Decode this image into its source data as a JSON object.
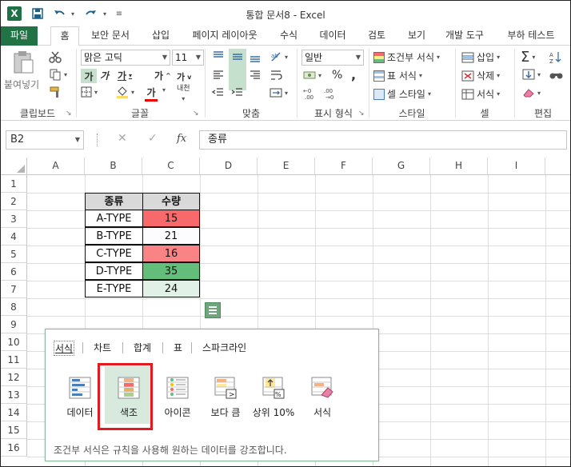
{
  "window": {
    "title": "통합 문서8 - Excel",
    "app_icon": "X"
  },
  "tabs": [
    "파일",
    "홈",
    "보안 문서",
    "삽입",
    "페이지 레이아웃",
    "수식",
    "데이터",
    "검토",
    "보기",
    "개발 도구",
    "부하 테스트"
  ],
  "active_tab": "홈",
  "ribbon": {
    "clipboard": {
      "paste": "붙여넣기",
      "label": "클립보드"
    },
    "font": {
      "name": "맑은 고딕",
      "size": "11",
      "bold": "가",
      "italic": "가",
      "underline": "가",
      "grow": "가",
      "shrink": "가",
      "phonetic": "내천",
      "color_glyph": "가",
      "label": "글꼴"
    },
    "alignment": {
      "label": "맞춤"
    },
    "number": {
      "format": "일반",
      "percent": "%",
      "comma": ",",
      "label": "표시 형식"
    },
    "styles": {
      "conditional": "조건부 서식",
      "table": "표 서식",
      "cell": "셀 스타일",
      "label": "스타일"
    },
    "cells": {
      "insert": "삽입",
      "delete": "삭제",
      "format": "서식",
      "label": "셀"
    },
    "editing": {
      "label": "편집"
    }
  },
  "formula_bar": {
    "name_box": "B2",
    "fx": "fx",
    "value": "종류"
  },
  "columns": [
    "A",
    "B",
    "C",
    "D",
    "E",
    "F",
    "G",
    "H",
    "I"
  ],
  "rows": [
    "1",
    "2",
    "3",
    "4",
    "5",
    "6",
    "7",
    "8",
    "9",
    "10",
    "11",
    "12",
    "13",
    "14",
    "15",
    "16"
  ],
  "table": {
    "headers": [
      "종류",
      "수량"
    ],
    "rows": [
      {
        "type": "A-TYPE",
        "qty": "15",
        "color": "#f8696b"
      },
      {
        "type": "B-TYPE",
        "qty": "21",
        "color": "#fcfcff"
      },
      {
        "type": "C-TYPE",
        "qty": "16",
        "color": "#f98385"
      },
      {
        "type": "D-TYPE",
        "qty": "35",
        "color": "#63be7b"
      },
      {
        "type": "E-TYPE",
        "qty": "24",
        "color": "#e2f1e7"
      }
    ]
  },
  "quick_analysis": {
    "tabs": [
      "서식",
      "차트",
      "합계",
      "표",
      "스파크라인"
    ],
    "active_tab": "서식",
    "tiles": [
      {
        "label": "데이터",
        "icon": "data-bars-icon"
      },
      {
        "label": "색조",
        "icon": "color-scale-icon"
      },
      {
        "label": "아이콘",
        "icon": "icon-set-icon"
      },
      {
        "label": "보다 큼",
        "icon": "greater-than-icon"
      },
      {
        "label": "상위 10%",
        "icon": "top-10-percent-icon"
      },
      {
        "label": "서식",
        "icon": "clear-format-icon"
      }
    ],
    "hint": "조건부 서식은 규칙을 사용해 원하는 데이터를 강조합니다."
  }
}
